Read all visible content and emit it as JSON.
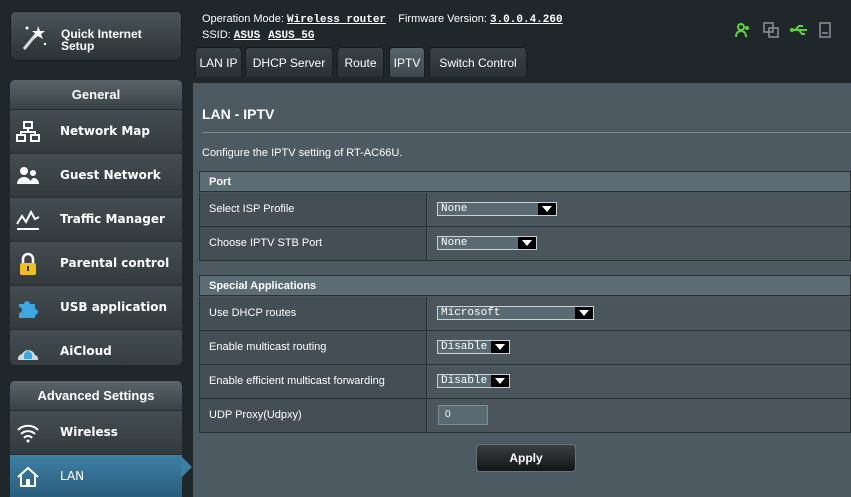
{
  "sidebar": {
    "qis_label_line1": "Quick Internet",
    "qis_label_line2": "Setup",
    "general_header": "General",
    "general_items": [
      {
        "label": "Network Map",
        "icon": "network-map-icon"
      },
      {
        "label": "Guest Network",
        "icon": "guest-network-icon"
      },
      {
        "label": "Traffic Manager",
        "icon": "traffic-manager-icon"
      },
      {
        "label": "Parental control",
        "icon": "lock-icon"
      },
      {
        "label": "USB application",
        "icon": "puzzle-icon"
      },
      {
        "label": "AiCloud",
        "icon": "cloud-house-icon"
      }
    ],
    "advanced_header": "Advanced Settings",
    "advanced_items": [
      {
        "label": "Wireless",
        "icon": "wifi-icon"
      },
      {
        "label": "LAN",
        "icon": "house-icon"
      }
    ]
  },
  "header": {
    "op_mode_label": "Operation Mode:",
    "op_mode_value": "Wireless router",
    "firmware_label": "Firmware Version:",
    "firmware_value": "3.0.0.4.260",
    "ssid_label": "SSID:",
    "ssid_values": [
      "ASUS",
      "ASUS_5G"
    ]
  },
  "tabs": [
    {
      "label": "LAN IP",
      "active": false
    },
    {
      "label": "DHCP Server",
      "active": false
    },
    {
      "label": "Route",
      "active": false
    },
    {
      "label": "IPTV",
      "active": true
    },
    {
      "label": "Switch Control",
      "active": false
    }
  ],
  "page": {
    "title": "LAN - IPTV",
    "description": "Configure the IPTV setting of RT-AC66U.",
    "port_section": {
      "header": "Port",
      "rows": [
        {
          "label": "Select ISP Profile",
          "value": "None"
        },
        {
          "label": "Choose IPTV STB Port",
          "value": "None"
        }
      ]
    },
    "special_section": {
      "header": "Special Applications",
      "rows": [
        {
          "label": "Use DHCP routes",
          "value": "Microsoft"
        },
        {
          "label": "Enable multicast routing",
          "value": "Disable"
        },
        {
          "label": "Enable efficient multicast forwarding",
          "value": "Disable"
        },
        {
          "label": "UDP Proxy(Udpxy)",
          "value": "0"
        }
      ]
    },
    "apply_label": "Apply"
  },
  "colors": {
    "accent_active": "#3d7ea4",
    "status_green": "#5fd13b",
    "panel_bg": "#4d5a61"
  }
}
